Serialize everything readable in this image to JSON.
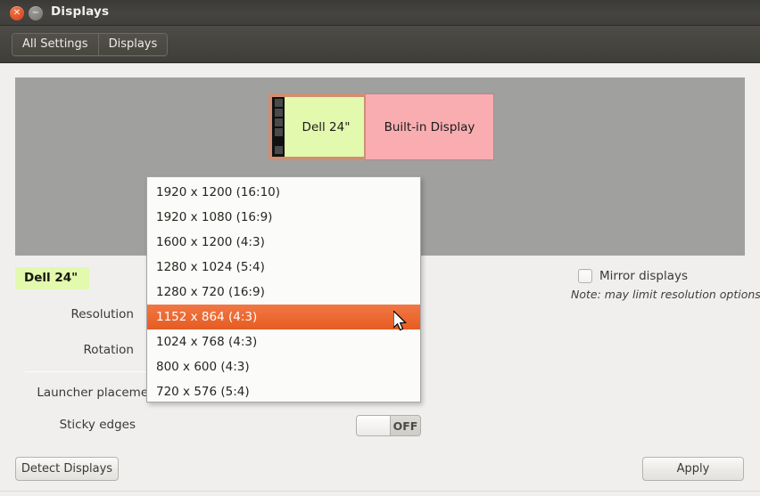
{
  "window": {
    "title": "Displays",
    "close_glyph": "✕",
    "minimize_glyph": "−"
  },
  "toolbar": {
    "buttons": [
      {
        "label": "All Settings"
      },
      {
        "label": "Displays"
      }
    ]
  },
  "preview": {
    "monitors": [
      {
        "name": "Dell 24\"",
        "selected": true
      },
      {
        "name": "Built-in Display",
        "selected": false
      }
    ]
  },
  "form": {
    "selected_display": "Dell 24\"",
    "labels": {
      "resolution": "Resolution",
      "rotation": "Rotation",
      "launcher_placement": "Launcher placement",
      "sticky_edges": "Sticky edges"
    },
    "sticky_edges_state": "OFF"
  },
  "mirror": {
    "label": "Mirror displays",
    "checked": false,
    "note": "Note: may limit resolution options"
  },
  "footer": {
    "detect_label": "Detect Displays",
    "apply_label": "Apply"
  },
  "resolution_dropdown": {
    "open": true,
    "selected_index": 5,
    "options": [
      {
        "label": "1920 x 1200 (16:10)"
      },
      {
        "label": "1920 x 1080 (16:9)"
      },
      {
        "label": "1600 x 1200 (4:3)"
      },
      {
        "label": "1280 x 1024 (5:4)"
      },
      {
        "label": "1280 x 720 (16:9)"
      },
      {
        "label": "1152 x 864 (4:3)"
      },
      {
        "label": "1024 x 768 (4:3)"
      },
      {
        "label": "800 x 600 (4:3)"
      },
      {
        "label": "720 x 576 (5:4)"
      }
    ]
  },
  "colors": {
    "titlebar": "#413f3b",
    "close_button": "#e1532a",
    "highlight": "#ec6a33",
    "monitor_selected_fill": "#e2f9ae",
    "monitor_other_fill": "#f9adb0",
    "preview_background": "#a0a09e",
    "window_background": "#f0efee"
  }
}
